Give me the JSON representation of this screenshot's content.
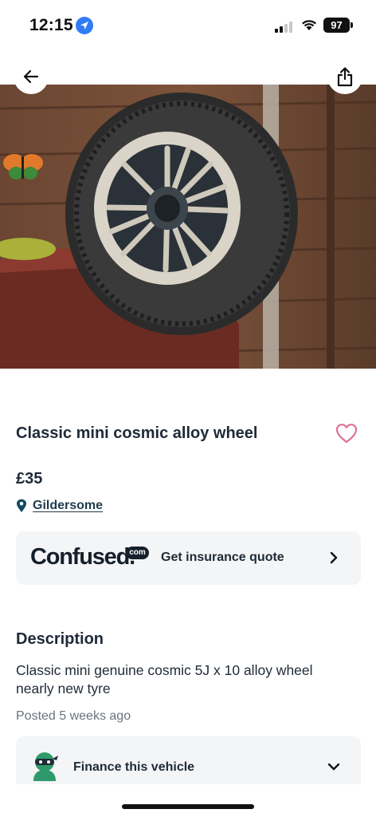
{
  "status_bar": {
    "time": "12:15",
    "battery": "97",
    "icons": [
      "location-arrow-icon",
      "cellular-signal-icon",
      "wifi-icon",
      "battery-icon"
    ]
  },
  "nav": {
    "back_icon": "arrow-left-icon",
    "share_icon": "share-icon"
  },
  "listing": {
    "title": "Classic mini cosmic alloy wheel",
    "price": "£35",
    "location": "Gildersome",
    "favourite_icon": "heart-outline-icon",
    "photo_subject": "wheel-photo"
  },
  "insurance": {
    "brand": "Confused.",
    "brand_suffix": "com",
    "cta": "Get insurance quote"
  },
  "description": {
    "heading": "Description",
    "body": "Classic mini genuine cosmic 5J x 10 alloy wheel nearly new tyre",
    "posted": "Posted 5 weeks ago"
  },
  "finance": {
    "label": "Finance this vehicle"
  },
  "colors": {
    "text": "#1f2a37",
    "muted": "#6b7280",
    "card": "#f4f5f7",
    "heart": "#e0709a",
    "pin": "#0f4a5c"
  }
}
